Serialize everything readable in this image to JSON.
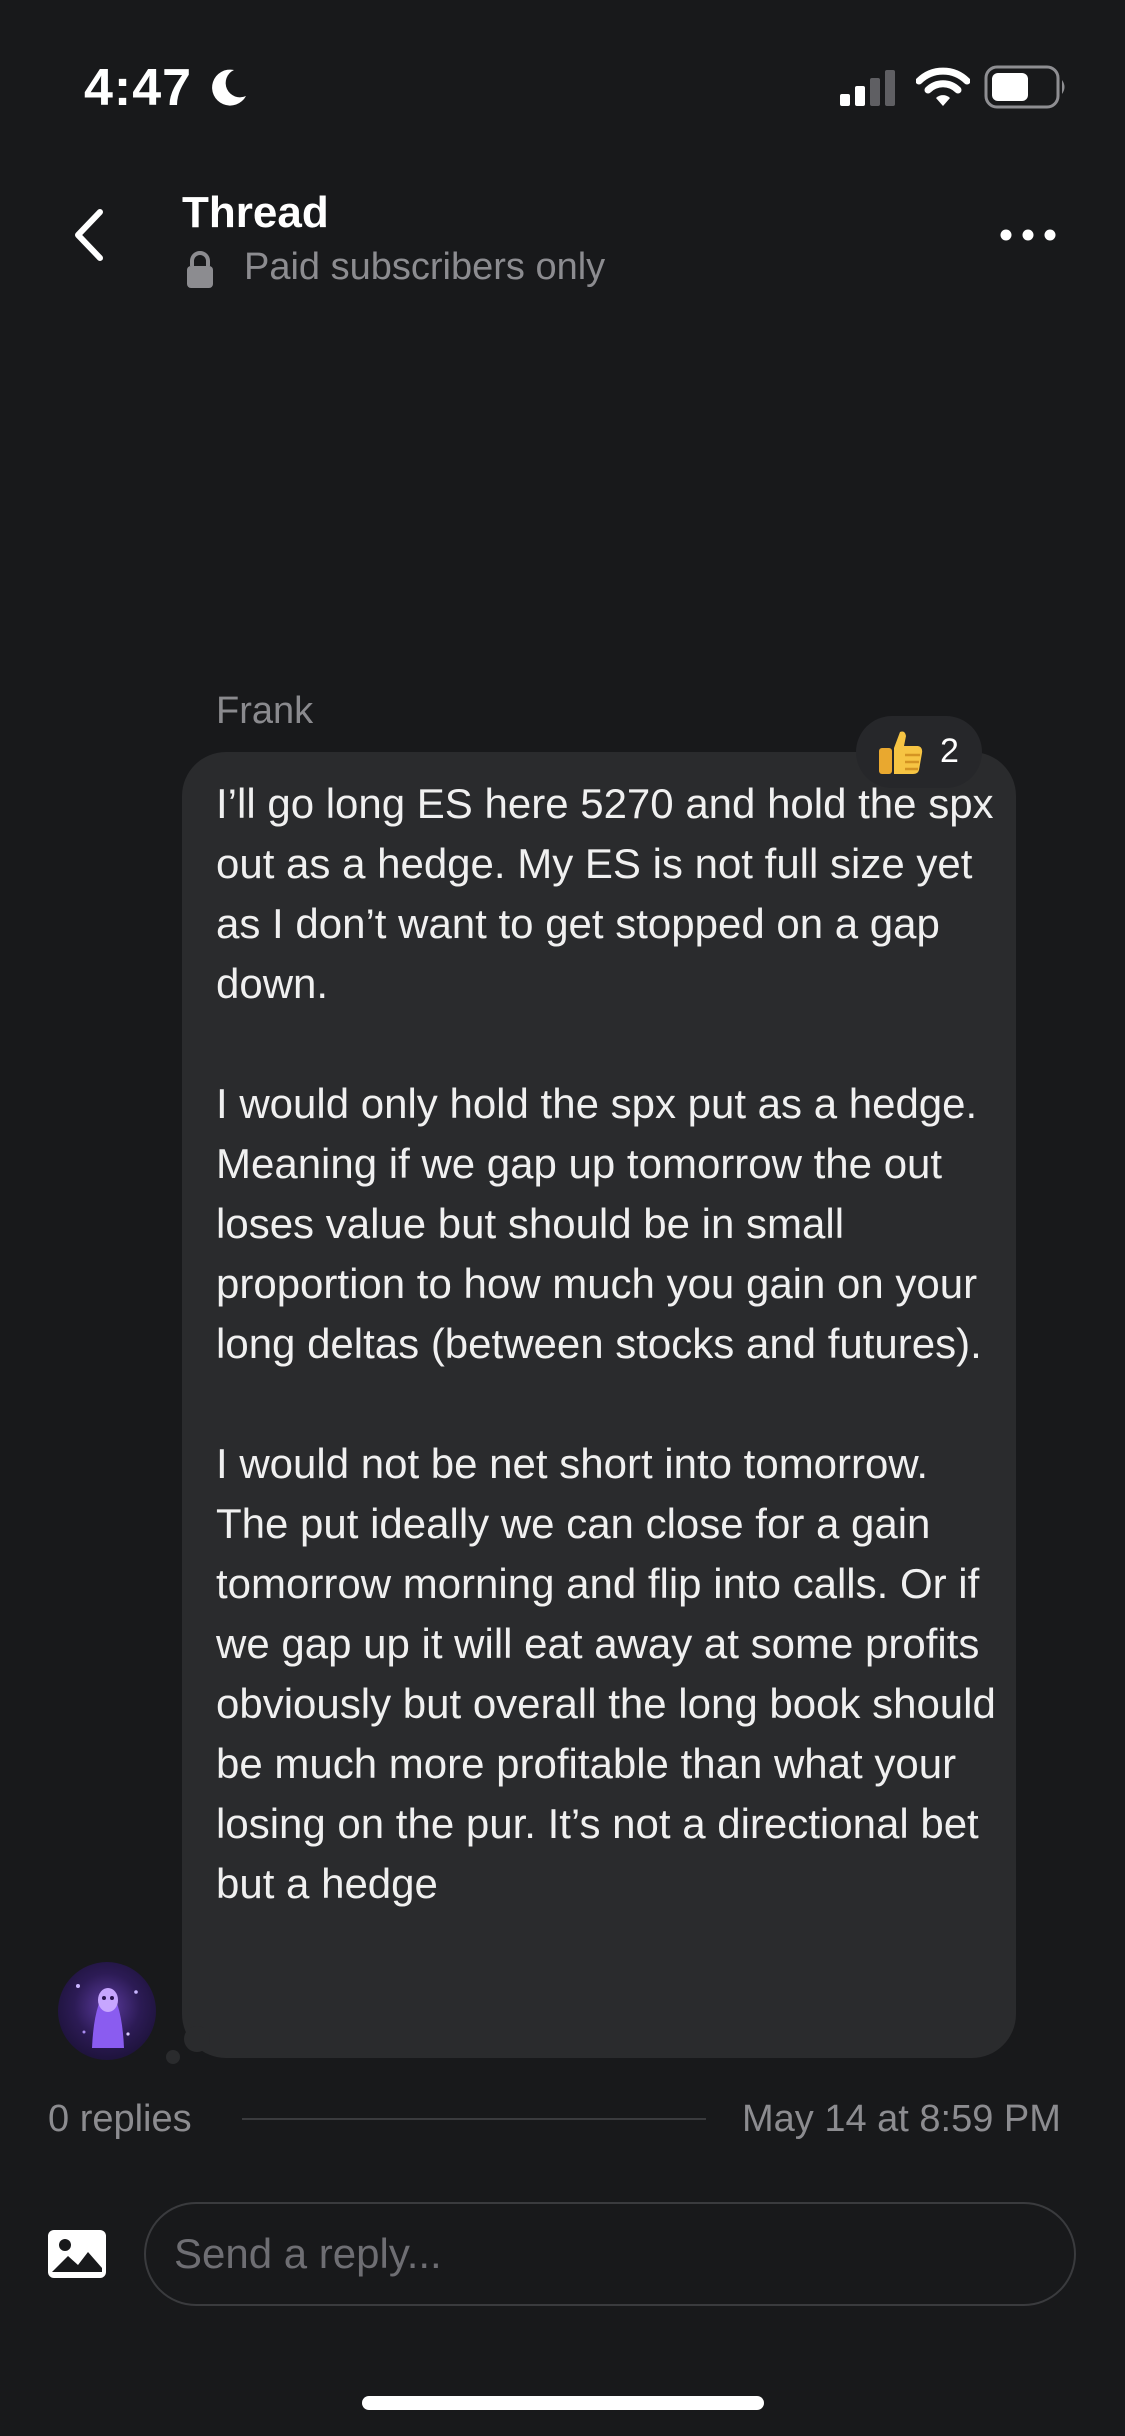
{
  "status_bar": {
    "time": "4:47",
    "icons": [
      "moon-icon",
      "signal-icon",
      "wifi-icon",
      "battery-icon"
    ]
  },
  "header": {
    "title": "Thread",
    "subtitle": "Paid subscribers only",
    "icons": [
      "chevron-left-icon",
      "lock-icon",
      "more-horizontal-icon"
    ]
  },
  "message": {
    "author": "Frank",
    "paragraphs": [
      "I’ll go long ES here 5270 and hold the spx out as a hedge. My ES is not full size yet as I don’t want to get stopped on a gap down.",
      "I would only hold the spx put as a hedge. Meaning if we gap up tomorrow the out loses value but should be in small proportion to how much you gain on your long deltas (between stocks and futures).",
      "I would not be net short into tomorrow. The put ideally we can close for a gain tomorrow morning and flip into calls. Or if we gap up it will eat away at some profits obviously but overall the long book should be much more profitable than what your losing on the pur. It’s not a directional bet but a hedge"
    ],
    "reaction": {
      "emoji": "thumbs-up-icon",
      "count": "2"
    }
  },
  "footer": {
    "replies": "0 replies",
    "timestamp": "May 14 at 8:59 PM"
  },
  "composer": {
    "placeholder": "Send a reply...",
    "value": "",
    "icon": "image-icon"
  },
  "colors": {
    "background": "#18191b",
    "bubble": "#2a2b2d",
    "text": "#f0f0f0",
    "muted": "#8c8c90"
  }
}
